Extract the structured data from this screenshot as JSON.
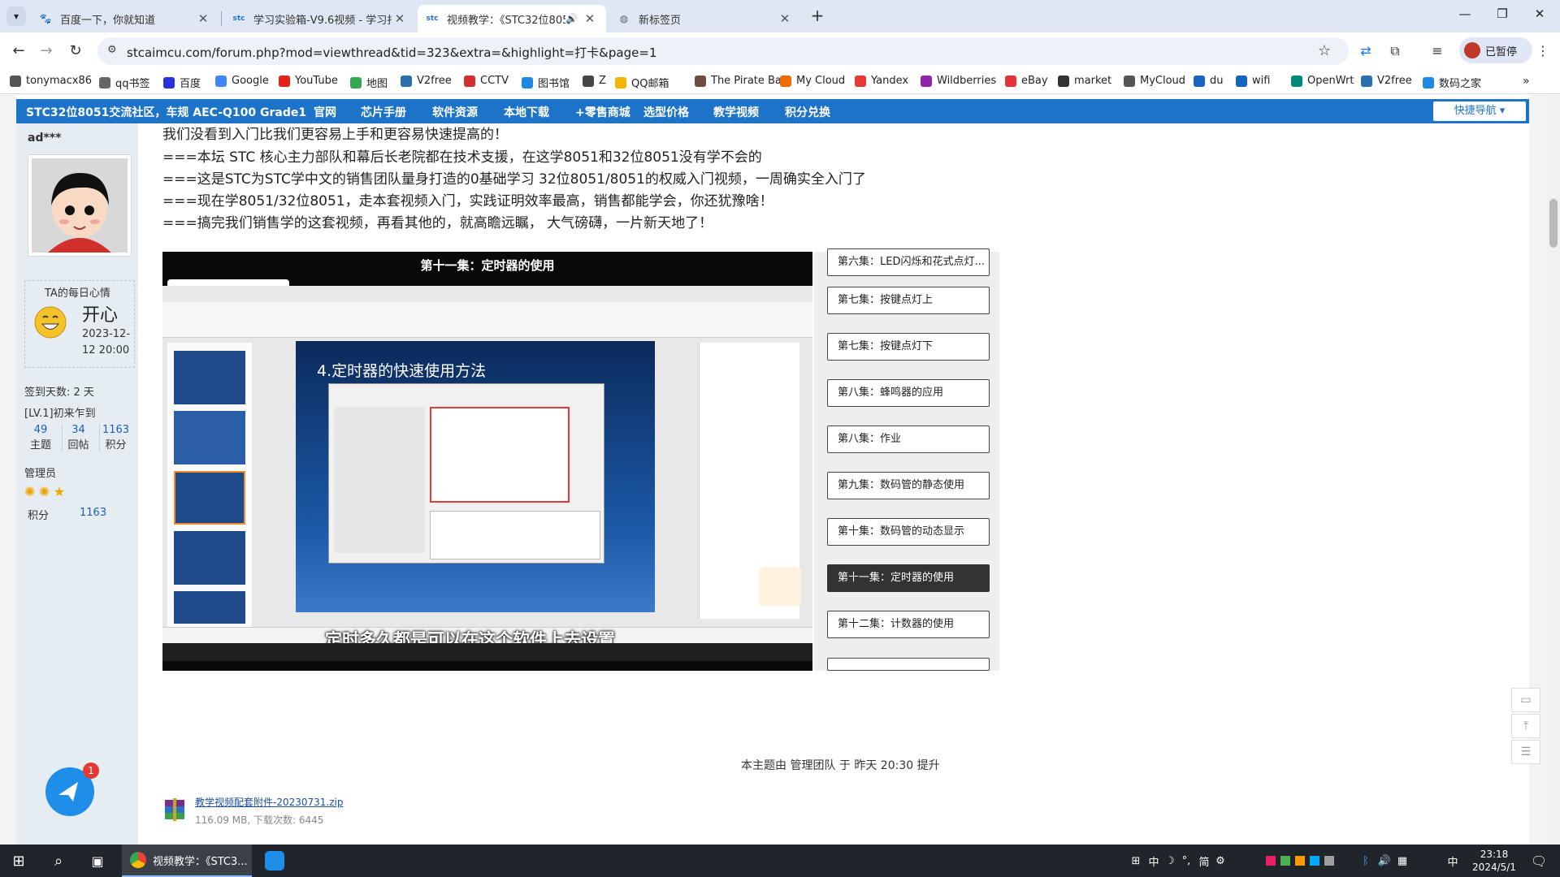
{
  "tabs": [
    {
      "title": "百度一下，你就知道",
      "icon": "baidu-icon",
      "active": false
    },
    {
      "title": "学习实验箱-V9.6视频 - 学习打",
      "icon": "stc-icon",
      "active": false
    },
    {
      "title": "视频教学：《STC32位805",
      "icon": "stc-icon",
      "active": true,
      "audio": true
    },
    {
      "title": "新标签页",
      "icon": "newtab-icon",
      "active": false
    }
  ],
  "toolbar": {
    "url": "stcaimcu.com/forum.php?mod=viewthread&tid=323&extra=&highlight=打卡&page=1",
    "profile_label": "已暂停"
  },
  "bookmarks": [
    {
      "label": "tonymacx86",
      "color": "#555"
    },
    {
      "label": "qq书签",
      "color": "#666"
    },
    {
      "label": "百度",
      "color": "#2932e1"
    },
    {
      "label": "Google",
      "color": "#4285f4"
    },
    {
      "label": "YouTube",
      "color": "#e62117"
    },
    {
      "label": "地图",
      "color": "#34a853"
    },
    {
      "label": "V2free",
      "color": "#2a6fb0"
    },
    {
      "label": "CCTV",
      "color": "#d32f2f"
    },
    {
      "label": "图书馆",
      "color": "#1e88e5"
    },
    {
      "label": "Z",
      "color": "#444"
    },
    {
      "label": "QQ邮箱",
      "color": "#f4b400"
    },
    {
      "label": "The Pirate Bay",
      "color": "#6d4c41"
    },
    {
      "label": "My Cloud",
      "color": "#ef6c00"
    },
    {
      "label": "Yandex",
      "color": "#e53935"
    },
    {
      "label": "Wildberries",
      "color": "#8e24aa"
    },
    {
      "label": "eBay",
      "color": "#e53238"
    },
    {
      "label": "market",
      "color": "#333"
    },
    {
      "label": "MyCloud",
      "color": "#555"
    },
    {
      "label": "du",
      "color": "#1565c0"
    },
    {
      "label": "wifi",
      "color": "#1565c0"
    },
    {
      "label": "OpenWrt",
      "color": "#00897b"
    },
    {
      "label": "V2free",
      "color": "#2a6fb0"
    },
    {
      "label": "数码之家",
      "color": "#1e88e5"
    }
  ],
  "sitenav": {
    "brand": "STC32位8051交流社区，车规 AEC-Q100 Grade1",
    "items": [
      "官网",
      "芯片手册",
      "软件资源",
      "本地下载",
      "+零售商城",
      "选型价格",
      "教学视频",
      "积分兑换"
    ],
    "quicknav": "快捷导航"
  },
  "user": {
    "name": "ad***",
    "mood_title": "TA的每日心情",
    "mood": "开心",
    "mood_date": "2023-12-12 20:00",
    "sign_days": "签到天数: 2 天",
    "level": "[LV.1]初来乍到",
    "stats": [
      {
        "value": "49",
        "label": "主题"
      },
      {
        "value": "34",
        "label": "回帖"
      },
      {
        "value": "1163",
        "label": "积分"
      }
    ],
    "role": "管理员",
    "points_label": "积分",
    "points": "1163"
  },
  "post": {
    "lines": [
      "我们没看到入门比我们更容易上手和更容易快速提高的！",
      "===本坛 STC  核心主力部队和幕后长老院都在技术支援，在这学8051和32位8051没有学不会的",
      "===这是STC为STC学中文的销售团队量身打造的0基础学习 32位8051/8051的权威入门视频，一周确实全入门了",
      "===现在学8051/32位8051，走本套视频入门，实践证明效率最高，销售都能学会，你还犹豫啥！",
      "===搞完我们销售学的这套视频，再看其他的，就高瞻远瞩， 大气磅礴，一片新天地了！"
    ],
    "video_title": "第十一集：定时器的使用",
    "slide_title": "4.定时器的快速使用方法",
    "subtitle": "定时多久都是可以在这个软件上去设置",
    "playlist": [
      {
        "label": "第六集：LED闪烁和花式点灯...",
        "active": false
      },
      {
        "label": "第七集：按键点灯上",
        "active": false
      },
      {
        "label": "第七集：按键点灯下",
        "active": false
      },
      {
        "label": "第八集：蜂鸣器的应用",
        "active": false
      },
      {
        "label": "第八集：作业",
        "active": false
      },
      {
        "label": "第九集：数码管的静态使用",
        "active": false
      },
      {
        "label": "第十集：数码管的动态显示",
        "active": false
      },
      {
        "label": "第十一集：定时器的使用",
        "active": true
      },
      {
        "label": "第十二集：计数器的使用",
        "active": false
      }
    ],
    "promoted_by": "本主题由 管理团队 于 昨天 20:30 提升",
    "attachment": {
      "name": "教学视频配套附件-20230731.zip",
      "info": "116.09 MB, 下载次数: 6445"
    }
  },
  "taskbar": {
    "app_label": "视频教学：《STC3...",
    "badge": "1",
    "ime": "中",
    "ime2": "简",
    "tray_ime": "中",
    "time": "23:18",
    "date": "2024/5/1"
  }
}
